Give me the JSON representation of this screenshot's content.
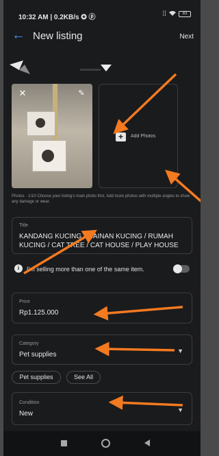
{
  "status_bar": {
    "time": "10:32 AM | 0.2KB/s ✪ ⓟ",
    "signal": "⁞⁞",
    "battery": "83"
  },
  "app_bar": {
    "back_icon": "arrow-left-icon",
    "title": "New listing",
    "next_label": "Next"
  },
  "photos": {
    "remove_icon": "✕",
    "edit_icon": "✎",
    "add_label": "Add Photos",
    "add_icon": "+",
    "hint": "Photos · 1/10 Choose your listing's main photo first. Add more photos with multiple angles to show any damage or wear."
  },
  "title_field": {
    "label": "Title",
    "value": "KANDANG KUCING / MAINAN KUCING / RUMAH KUCING / CAT TREE / CAT HOUSE / PLAY HOUSE"
  },
  "multi_item": {
    "info_icon": "i",
    "text": "I'm selling more than one of the same item.",
    "enabled": false
  },
  "price_field": {
    "label": "Price",
    "value": "Rp1.125.000"
  },
  "category_field": {
    "label": "Category",
    "value": "Pet supplies",
    "caret": "▼"
  },
  "category_chips": [
    "Pet supplies",
    "See All"
  ],
  "condition_field": {
    "label": "Condition",
    "value": "New",
    "caret": "▼"
  },
  "colors": {
    "background": "#1a1b1d",
    "accent": "#4d8ff7",
    "annotation_arrow": "#f47a20"
  }
}
